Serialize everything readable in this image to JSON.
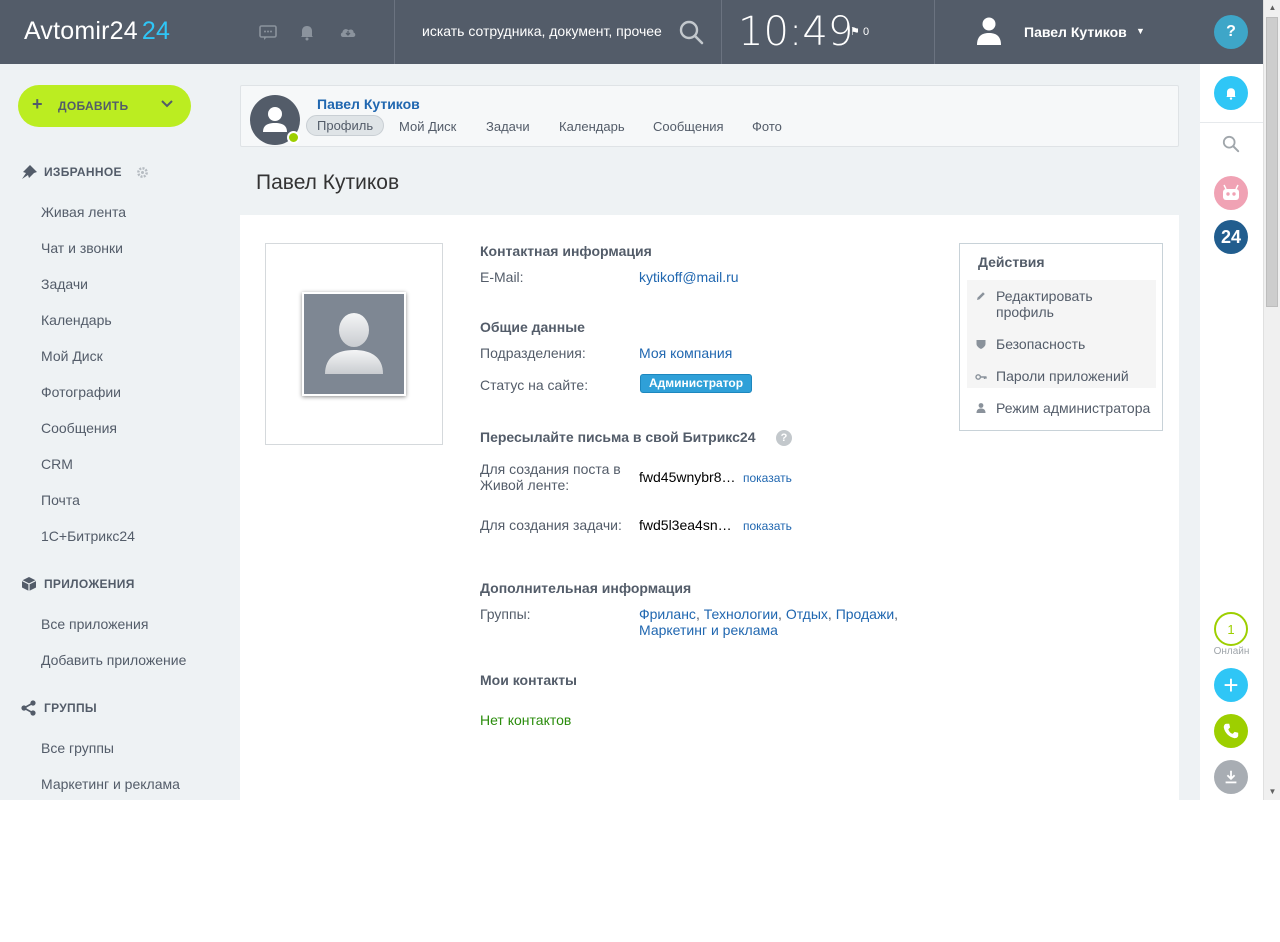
{
  "header": {
    "logo_main": "Avtomir24",
    "logo_num": "24",
    "search_placeholder": "искать сотрудника, документ, прочее",
    "clock": "10:49",
    "flag_count": "0",
    "user_name": "Павел Кутиков"
  },
  "right_panel": {
    "help": "?",
    "badge_24": "24",
    "online_count": "1",
    "online_label": "Онлайн"
  },
  "sidebar": {
    "add_button": "ДОБАВИТЬ",
    "favorites_title": "ИЗБРАННОЕ",
    "favorites": [
      "Живая лента",
      "Чат и звонки",
      "Задачи",
      "Календарь",
      "Мой Диск",
      "Фотографии",
      "Сообщения",
      "CRM",
      "Почта",
      "1С+Битрикс24"
    ],
    "apps_title": "ПРИЛОЖЕНИЯ",
    "apps": [
      "Все приложения",
      "Добавить приложение"
    ],
    "groups_title": "ГРУППЫ",
    "groups": [
      "Все группы",
      "Маркетинг и реклама"
    ]
  },
  "profile_bar": {
    "name": "Павел Кутиков",
    "tabs": [
      "Профиль",
      "Мой Диск",
      "Задачи",
      "Календарь",
      "Сообщения",
      "Фото"
    ]
  },
  "page_title": "Павел Кутиков",
  "contact": {
    "title": "Контактная информация",
    "email_label": "E-Mail:",
    "email_value": "kytikoff@mail.ru"
  },
  "general": {
    "title": "Общие данные",
    "dept_label": "Подразделения:",
    "dept_value": "Моя компания",
    "status_label": "Статус на сайте:",
    "status_value": "Администратор"
  },
  "forward": {
    "title": "Пересылайте письма в свой Битрикс24",
    "post_label": "Для создания поста в Живой ленте:",
    "post_value": "fwd45wnybr8…",
    "task_label": "Для создания задачи:",
    "task_value": "fwd5l3ea4sn…",
    "show": "показать"
  },
  "additional": {
    "title": "Дополнительная информация",
    "groups_label": "Группы:",
    "groups": [
      "Фриланс",
      "Технологии",
      "Отдых",
      "Продажи",
      "Маркетинг и реклама"
    ]
  },
  "contacts": {
    "title": "Мои контакты",
    "empty": "Нет контактов"
  },
  "actions": {
    "title": "Действия",
    "items": [
      "Редактировать профиль",
      "Безопасность",
      "Пароли приложений",
      "Режим администратора"
    ]
  },
  "colors": {
    "header_bg": "#535c69",
    "accent_green": "#bbed21",
    "link_blue": "#2067b0",
    "online_green": "#9dcf00",
    "cyan": "#2fc6f6"
  }
}
